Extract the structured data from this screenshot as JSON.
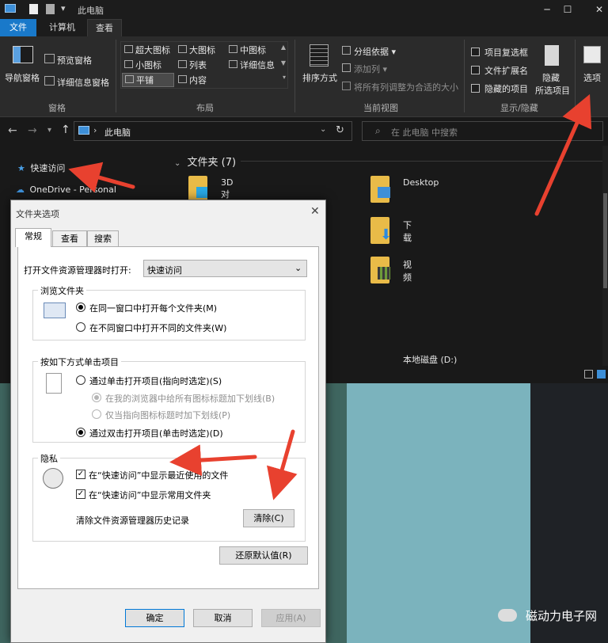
{
  "window": {
    "title": "此电脑"
  },
  "ribbon_tabs": [
    "文件",
    "计算机",
    "查看"
  ],
  "ribbon": {
    "pane": {
      "nav_pane": "导航窗格",
      "preview_pane": "预览窗格",
      "details_pane": "详细信息窗格",
      "group": "窗格"
    },
    "layout": {
      "xl_icons": "超大图标",
      "l_icons": "大图标",
      "m_icons": "中图标",
      "s_icons": "小图标",
      "list": "列表",
      "details": "详细信息",
      "tiles": "平铺",
      "content": "内容",
      "group": "布局"
    },
    "current_view": {
      "sort": "排序方式",
      "group_by": "分组依据",
      "add_column": "添加列",
      "fit_columns": "将所有列调整为合适的大小",
      "group": "当前视图"
    },
    "show_hide": {
      "item_checkboxes": "项目复选框",
      "extensions": "文件扩展名",
      "hidden_items": "隐藏的项目",
      "hide": "隐藏",
      "hide_selected": "所选项目",
      "group": "显示/隐藏"
    },
    "options": "选项"
  },
  "address": {
    "path": "此电脑",
    "search_placeholder": "在 此电脑 中搜索"
  },
  "nav": {
    "quick_access": "快速访问",
    "onedrive": "OneDrive - Personal"
  },
  "content": {
    "folders_header": "文件夹 (7)",
    "folders": [
      "3D 对象",
      "Desktop",
      "下载",
      "视频"
    ],
    "drive": "本地磁盘 (D:)"
  },
  "dialog": {
    "title": "文件夹选项",
    "tabs": [
      "常规",
      "查看",
      "搜索"
    ],
    "open_with_label": "打开文件资源管理器时打开:",
    "open_with_value": "快速访问",
    "browse": {
      "title": "浏览文件夹",
      "same_window": "在同一窗口中打开每个文件夹(M)",
      "new_window": "在不同窗口中打开不同的文件夹(W)"
    },
    "click": {
      "title": "按如下方式单击项目",
      "single": "通过单击打开项目(指向时选定)(S)",
      "underline_browser": "在我的浏览器中给所有图标标题加下划线(B)",
      "underline_point": "仅当指向图标标题时加下划线(P)",
      "double": "通过双击打开项目(单击时选定)(D)"
    },
    "privacy": {
      "title": "隐私",
      "recent_files": "在“快速访问”中显示最近使用的文件",
      "frequent_folders": "在“快速访问”中显示常用文件夹",
      "clear_label": "清除文件资源管理器历史记录",
      "clear_button": "清除(C)"
    },
    "restore_defaults": "还原默认值(R)",
    "ok": "确定",
    "cancel": "取消",
    "apply": "应用(A)"
  },
  "watermark": "磁动力电子网",
  "colors": {
    "accent": "#1979ca",
    "arrow": "#e8412f",
    "dialog_bg": "#f0f0f0"
  }
}
